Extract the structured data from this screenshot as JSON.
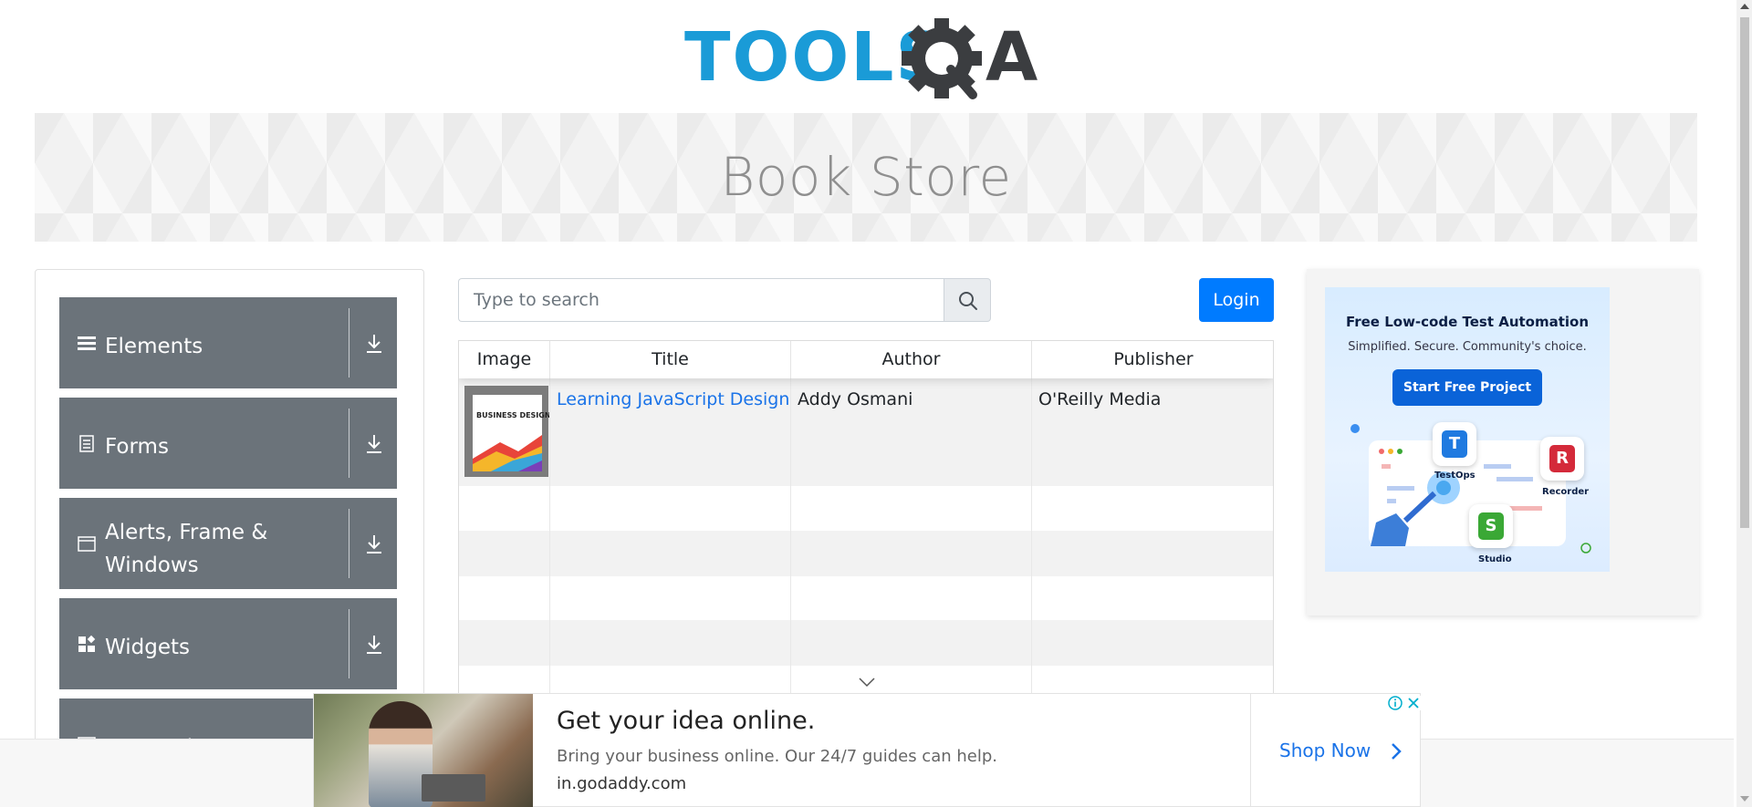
{
  "logo": {
    "alt": "TOOLSQA",
    "text_tools": "TOOLS",
    "text_a": "A"
  },
  "banner": {
    "title": "Book Store"
  },
  "sidebar": {
    "groups": [
      {
        "label": "Elements",
        "icon": "hamburger-icon"
      },
      {
        "label": "Forms",
        "icon": "form-document-icon"
      },
      {
        "label": "Alerts, Frame & Windows",
        "icon": "browser-window-icon"
      },
      {
        "label": "Widgets",
        "icon": "widgets-icon"
      },
      {
        "label": "Interactions",
        "icon": "interactions-icon"
      }
    ]
  },
  "search": {
    "placeholder": "Type to search",
    "value": ""
  },
  "login": {
    "label": "Login"
  },
  "table": {
    "headers": [
      "Image",
      "Title",
      "Author",
      "Publisher"
    ],
    "rows": [
      {
        "title": "Learning JavaScript Design Patterns",
        "author": "Addy Osmani",
        "publisher": "O'Reilly Media",
        "cover_text": "BUSINESS DESIGN"
      }
    ]
  },
  "right_ad": {
    "title": "Free Low-code Test Automation",
    "subtitle": "Simplified. Secure. Community's choice.",
    "button": "Start Free Project",
    "tiles": [
      {
        "letter": "T",
        "label": "TestOps",
        "color": "#1f7ae0"
      },
      {
        "letter": "R",
        "label": "Recorder",
        "color": "#d42a3a"
      },
      {
        "letter": "S",
        "label": "Studio",
        "color": "#3aa835"
      }
    ]
  },
  "bottom_ad": {
    "headline": "Get your idea online.",
    "description": "Bring your business online. Our 24/7 guides can help.",
    "domain": "in.godaddy.com",
    "cta": "Shop Now"
  },
  "colors": {
    "accent": "#007bff",
    "sidebar_group": "#6b737a",
    "link": "#1a73e8",
    "logo_blue": "#1a9bd7",
    "logo_dark": "#3b3d40"
  }
}
